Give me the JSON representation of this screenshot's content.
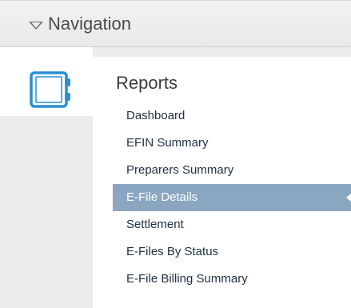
{
  "navigation": {
    "title": "Navigation",
    "caret_icon": "caret-down-icon"
  },
  "rail": {
    "selected_icon": "notebook-icon",
    "icon_color": "#2a8fd4"
  },
  "reports": {
    "title": "Reports",
    "items": [
      {
        "label": "Dashboard",
        "active": false
      },
      {
        "label": "EFIN Summary",
        "active": false
      },
      {
        "label": "Preparers Summary",
        "active": false
      },
      {
        "label": "E-File Details",
        "active": true
      },
      {
        "label": "Settlement",
        "active": false
      },
      {
        "label": "E-Files By Status",
        "active": false
      },
      {
        "label": "E-File Billing Summary",
        "active": false
      }
    ]
  },
  "colors": {
    "active_item_bg": "#8aa6c1",
    "rail_bg": "#ececec",
    "menu_text": "#1f2f43"
  }
}
